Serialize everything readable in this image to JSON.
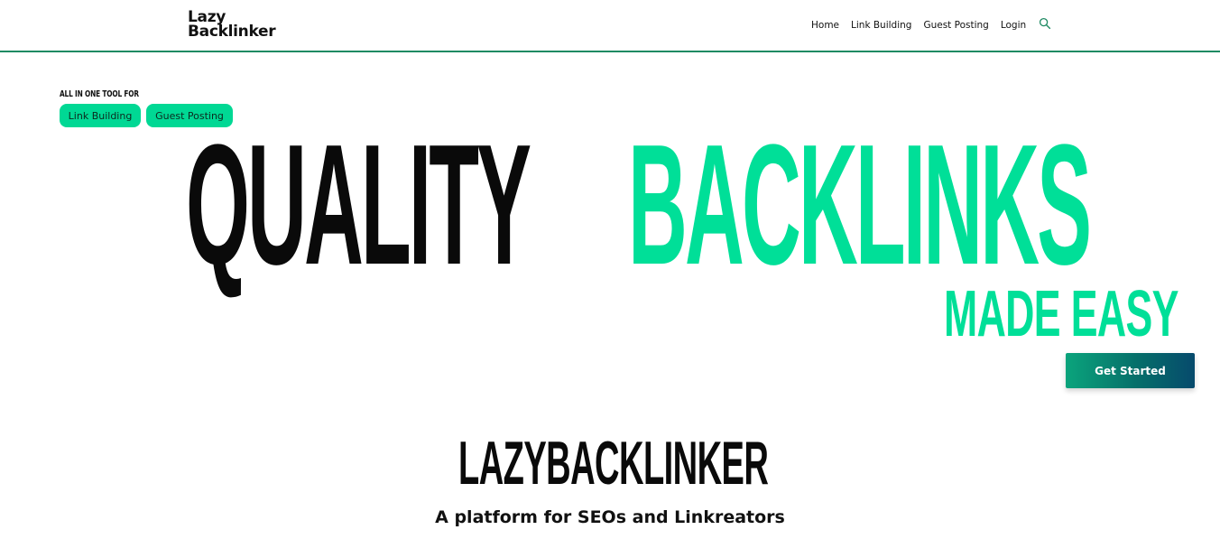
{
  "header": {
    "logo_line1": "Lazy",
    "logo_line2": "Backlinker",
    "nav": [
      "Home",
      "Link Building",
      "Guest Posting",
      "Login"
    ],
    "search_icon": "search-icon"
  },
  "hero": {
    "kicker": "ALL IN ONE TOOL FOR",
    "pills": [
      "Link Building",
      "Guest Posting"
    ],
    "headline_dark": "QUALITY",
    "headline_green": "BACKLINKS",
    "subheadline": "MADE EASY",
    "cta_label": "Get Started"
  },
  "intro": {
    "brand": "LAZYBACKLINKER",
    "tagline": "A platform for SEOs and Linkreators"
  },
  "colors": {
    "accent": "#00df98",
    "header_rule": "#1f8a63",
    "cta_gradient_start": "#0aa47c",
    "cta_gradient_end": "#064a6c"
  }
}
